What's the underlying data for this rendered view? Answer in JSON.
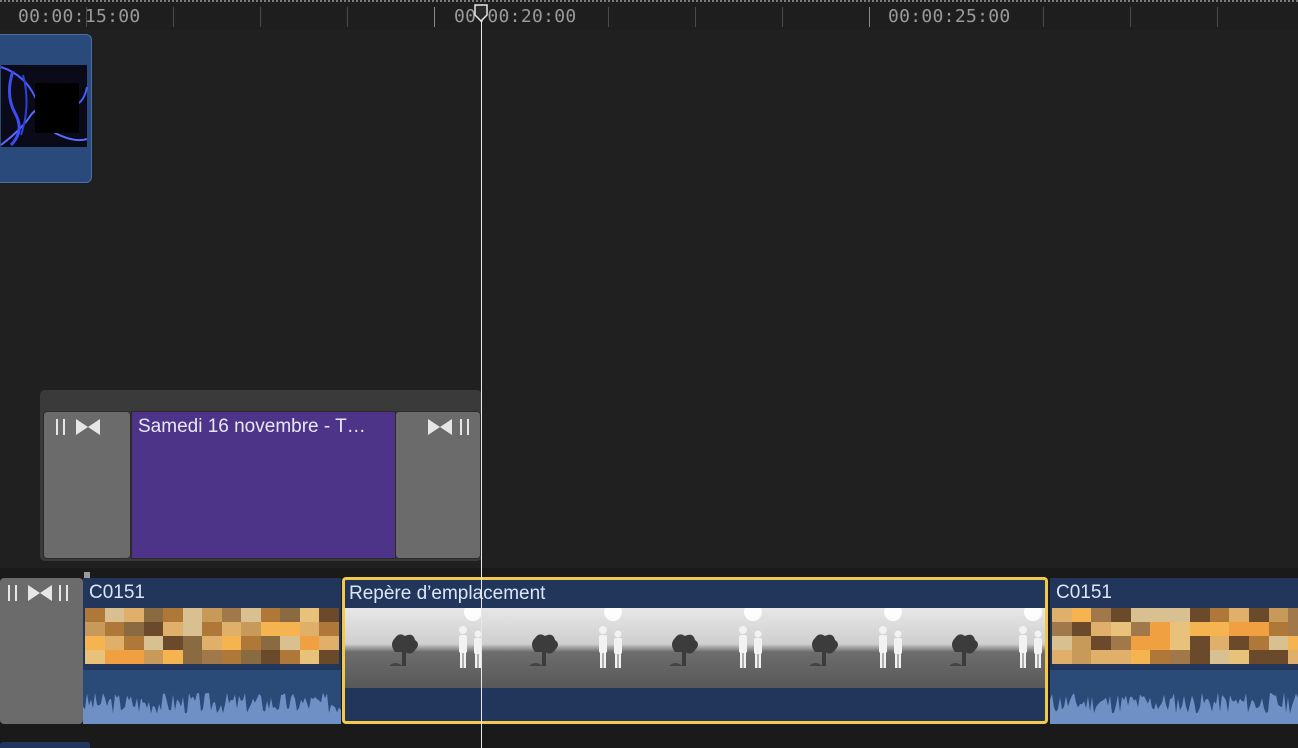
{
  "ruler": {
    "timecodes": [
      "00:00:15:00",
      "00:00:20:00",
      "00:00:25:00"
    ]
  },
  "playhead": {
    "timecode": "00:00:20:00"
  },
  "connected_clip": {
    "name": ""
  },
  "title_clip": {
    "label": "Samedi 16 novembre - T…"
  },
  "storyline": {
    "clips": [
      {
        "name": "C0151"
      },
      {
        "name": "Repère d’emplacement",
        "selected": true
      },
      {
        "name": "C0151"
      }
    ]
  },
  "colors": {
    "selection": "#f2c94c",
    "clip_blue": "#21365a",
    "title_purple": "#4d3488",
    "transition_gray": "#6b6b6b",
    "playhead": "#e8e8e8"
  },
  "icons": [
    "transition-icon",
    "playhead-handle-icon"
  ]
}
